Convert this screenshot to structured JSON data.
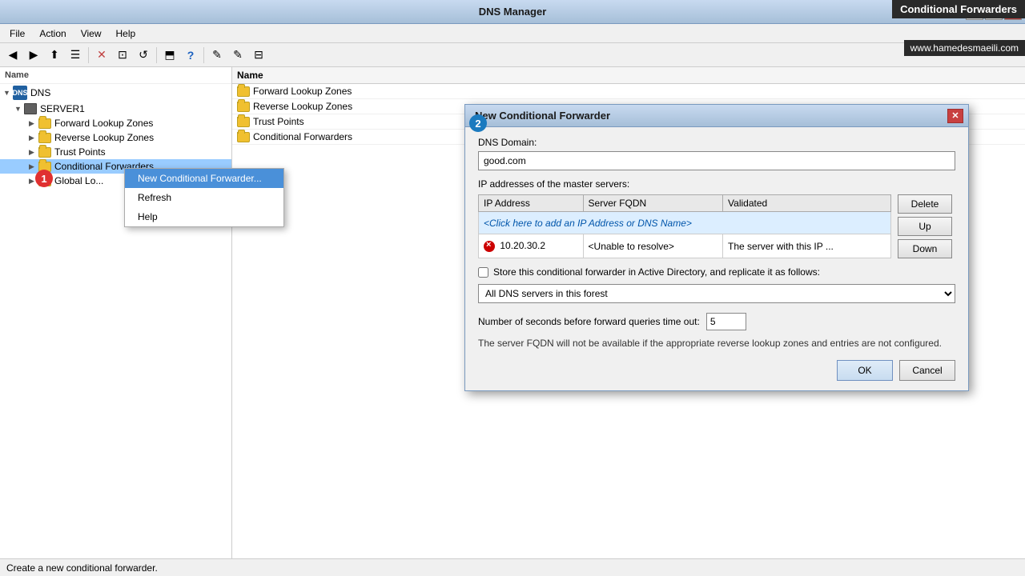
{
  "titleBar": {
    "title": "DNS Manager",
    "buttons": [
      "—",
      "□",
      "✕"
    ]
  },
  "menuBar": {
    "items": [
      "File",
      "Action",
      "View",
      "Help"
    ]
  },
  "toolbar": {
    "buttons": [
      "◀",
      "▶",
      "⬆",
      "☰",
      "✕",
      "↺",
      "⟳",
      "?",
      "⊟",
      "✎",
      "✎",
      "✎",
      "⬒"
    ]
  },
  "treePanel": {
    "header": "Name",
    "nodes": [
      {
        "label": "DNS",
        "level": 0,
        "expanded": true,
        "type": "dns"
      },
      {
        "label": "SERVER1",
        "level": 1,
        "expanded": true,
        "type": "server"
      },
      {
        "label": "Forward Lookup Zones",
        "level": 2,
        "expanded": false,
        "type": "folder"
      },
      {
        "label": "Reverse Lookup Zones",
        "level": 2,
        "expanded": false,
        "type": "folder"
      },
      {
        "label": "Trust Points",
        "level": 2,
        "expanded": false,
        "type": "folder"
      },
      {
        "label": "Conditional Forwarders",
        "level": 2,
        "expanded": false,
        "type": "folder",
        "selected": true
      },
      {
        "label": "Global Logs",
        "level": 2,
        "expanded": false,
        "type": "folder"
      }
    ]
  },
  "listPanel": {
    "header": "Name",
    "items": [
      {
        "label": "Forward Lookup Zones",
        "type": "folder"
      },
      {
        "label": "Reverse Lookup Zones",
        "type": "folder"
      },
      {
        "label": "Trust Points",
        "type": "folder"
      },
      {
        "label": "Conditional Forwarders",
        "type": "folder"
      }
    ]
  },
  "contextMenu": {
    "items": [
      {
        "label": "New Conditional Forwarder...",
        "highlighted": true
      },
      {
        "label": "Refresh"
      },
      {
        "label": "Help"
      }
    ]
  },
  "dialog": {
    "title": "New Conditional Forwarder",
    "dns_domain_label": "DNS Domain:",
    "dns_domain_value": "good.com",
    "ip_addresses_label": "IP addresses of the master servers:",
    "table": {
      "columns": [
        "IP Address",
        "Server FQDN",
        "Validated"
      ],
      "rows": [
        {
          "ip": "<Click here to add an IP Address or DNS Name>",
          "fqdn": "",
          "validated": "",
          "type": "add"
        },
        {
          "ip": "10.20.30.2",
          "fqdn": "<Unable to resolve>",
          "validated": "The server with this IP ...",
          "type": "data",
          "error": true
        }
      ]
    },
    "sideButtons": [
      "Delete",
      "Up",
      "Down"
    ],
    "checkboxLabel": "Store this conditional forwarder in Active Directory, and replicate it as follows:",
    "checkboxChecked": false,
    "dropdownOptions": [
      "All DNS servers in this forest"
    ],
    "dropdownSelected": "All DNS servers in this forest",
    "timeoutLabel": "Number of seconds before forward queries time out:",
    "timeoutValue": "5",
    "footerNote": "The server FQDN will not be available if the appropriate reverse lookup zones and entries are not configured.",
    "buttons": {
      "ok": "OK",
      "cancel": "Cancel"
    }
  },
  "statusBar": {
    "text": "Create a new conditional forwarder."
  },
  "tooltip": {
    "title": "Conditional Forwarders",
    "url": "www.hamedesmaeili.com"
  },
  "badges": {
    "badge1": "1",
    "badge2": "2"
  }
}
